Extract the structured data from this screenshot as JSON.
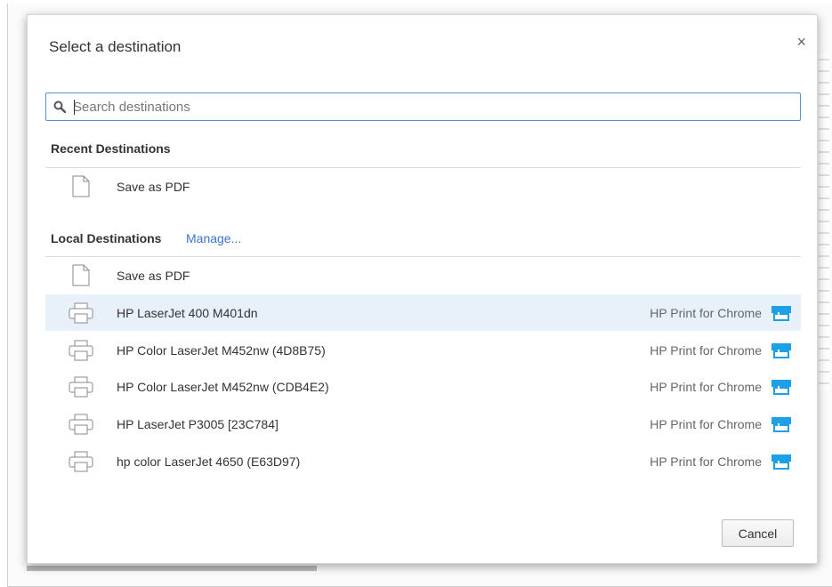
{
  "dialog": {
    "title": "Select a destination",
    "close_symbol": "×",
    "search": {
      "placeholder": "Search destinations",
      "value": ""
    },
    "recent_section": {
      "heading": "Recent Destinations",
      "items": [
        {
          "label": "Save as PDF",
          "icon": "document-icon"
        }
      ]
    },
    "local_section": {
      "heading": "Local Destinations",
      "manage_label": "Manage...",
      "items": [
        {
          "label": "Save as PDF",
          "icon": "document-icon",
          "extension": ""
        },
        {
          "label": "HP LaserJet 400 M401dn",
          "icon": "printer-icon",
          "extension": "HP Print for Chrome",
          "highlighted": true
        },
        {
          "label": "HP Color LaserJet M452nw (4D8B75)",
          "icon": "printer-icon",
          "extension": "HP Print for Chrome"
        },
        {
          "label": "HP Color LaserJet M452nw (CDB4E2)",
          "icon": "printer-icon",
          "extension": "HP Print for Chrome"
        },
        {
          "label": "HP LaserJet P3005 [23C784]",
          "icon": "printer-icon",
          "extension": "HP Print for Chrome"
        },
        {
          "label": "hp color LaserJet 4650 (E63D97)",
          "icon": "printer-icon",
          "extension": "HP Print for Chrome"
        }
      ]
    },
    "cancel_label": "Cancel"
  },
  "colors": {
    "accent": "#3b73d0",
    "highlight_row": "#e8f0fa",
    "extension_icon": "#1ea0e8"
  }
}
